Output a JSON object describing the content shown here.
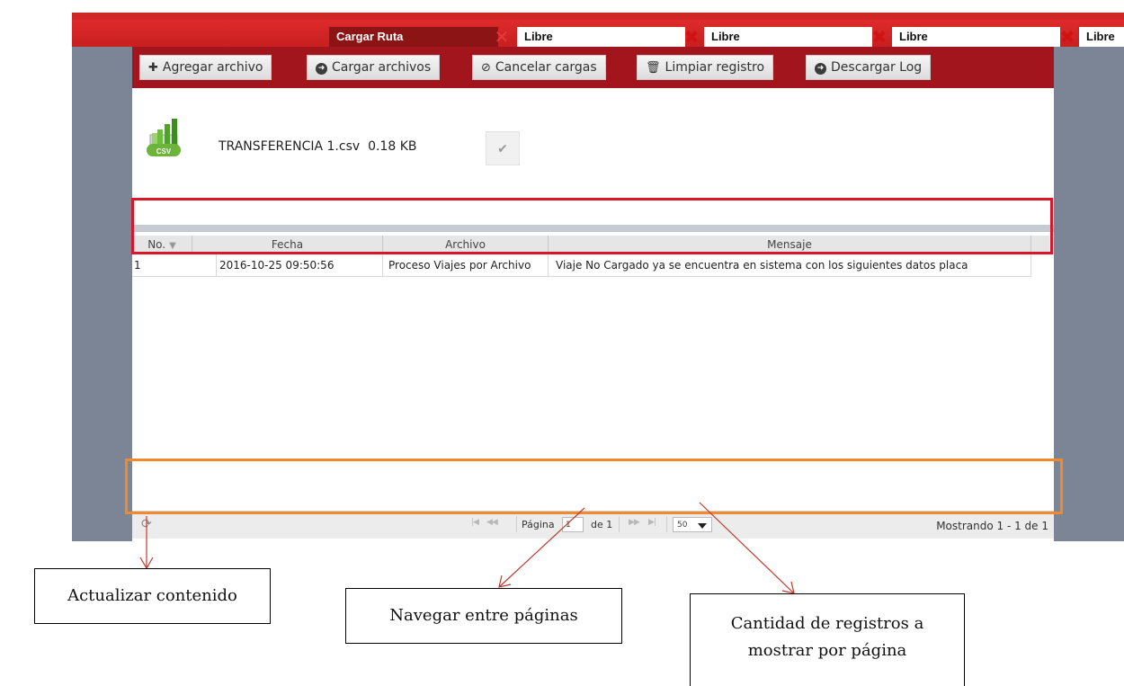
{
  "tabs": [
    {
      "label": "Cargar Ruta",
      "active": true
    },
    {
      "label": "Libre",
      "active": false
    },
    {
      "label": "Libre",
      "active": false
    },
    {
      "label": "Libre",
      "active": false
    },
    {
      "label": "Libre",
      "active": false
    }
  ],
  "toolbar": {
    "add_label": "Agregar archivo",
    "upload_label": "Cargar archivos",
    "cancel_label": "Cancelar cargas",
    "clear_label": "Limpiar registro",
    "download_label": "Descargar Log"
  },
  "file": {
    "icon_text": "CSV",
    "name": "TRANSFERENCIA 1.csv",
    "size": "0.18 KB"
  },
  "grid": {
    "columns": [
      "No.",
      "Fecha",
      "Archivo",
      "Mensaje"
    ],
    "rows": [
      {
        "no": "1",
        "fecha": "2016-10-25 09:50:56",
        "archivo": "Proceso Viajes por Archivo",
        "mensaje": "Viaje No Cargado ya se encuentra en sistema con los siguientes datos placa"
      }
    ]
  },
  "pager": {
    "page_label": "Página",
    "page_value": "1",
    "of_label": "de 1",
    "page_size": "50",
    "showing": "Mostrando 1 - 1 de 1"
  },
  "callouts": {
    "refresh": "Actualizar contenido",
    "navigate": "Navegar entre páginas",
    "page_size_line1": "Cantidad de registros a",
    "page_size_line2": "mostrar por página"
  },
  "colors": {
    "tab_bar": "#d12626",
    "active_tab": "#8d1414",
    "toolbar": "#a3151c",
    "highlight_red": "#d8182a",
    "highlight_orange": "#f18a2c",
    "arrow": "#c0392b"
  }
}
